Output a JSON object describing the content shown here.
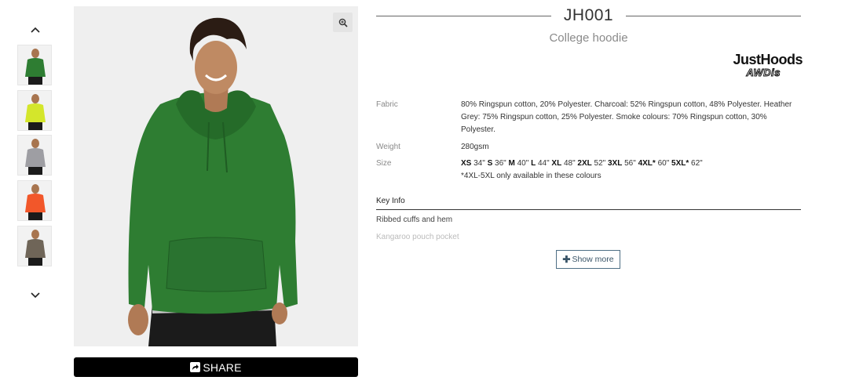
{
  "gallery": {
    "thumb_colors": [
      "#2e7d32",
      "#d4e62b",
      "#9e9ea3",
      "#f2572a",
      "#6f6558"
    ],
    "main_color": "#2e7d32"
  },
  "share": {
    "label": "SHARE"
  },
  "product": {
    "code": "JH001",
    "name": "College hoodie",
    "brand_main": "JustHoods",
    "brand_sub": "AWDis"
  },
  "specs": {
    "fabric_label": "Fabric",
    "fabric_value": "80% Ringspun cotton, 20% Polyester. Charcoal: 52% Ringspun cotton, 48% Polyester. Heather Grey: 75% Ringspun cotton, 25% Polyester. Smoke colours: 70% Ringspun cotton, 30% Polyester.",
    "weight_label": "Weight",
    "weight_value": "280gsm",
    "size_label": "Size",
    "sizes": [
      {
        "size": "XS",
        "measure": "34\""
      },
      {
        "size": "S",
        "measure": "36\""
      },
      {
        "size": "M",
        "measure": "40\""
      },
      {
        "size": "L",
        "measure": "44\""
      },
      {
        "size": "XL",
        "measure": "48\""
      },
      {
        "size": "2XL",
        "measure": "52\""
      },
      {
        "size": "3XL",
        "measure": "56\""
      },
      {
        "size": "4XL*",
        "measure": "60\""
      },
      {
        "size": "5XL*",
        "measure": "62\""
      }
    ],
    "size_note": "*4XL-5XL only available in these colours"
  },
  "key_info": {
    "title": "Key Info",
    "items": [
      "Ribbed cuffs and hem",
      "Kangaroo pouch pocket"
    ]
  },
  "show_more": {
    "label": "Show more"
  }
}
